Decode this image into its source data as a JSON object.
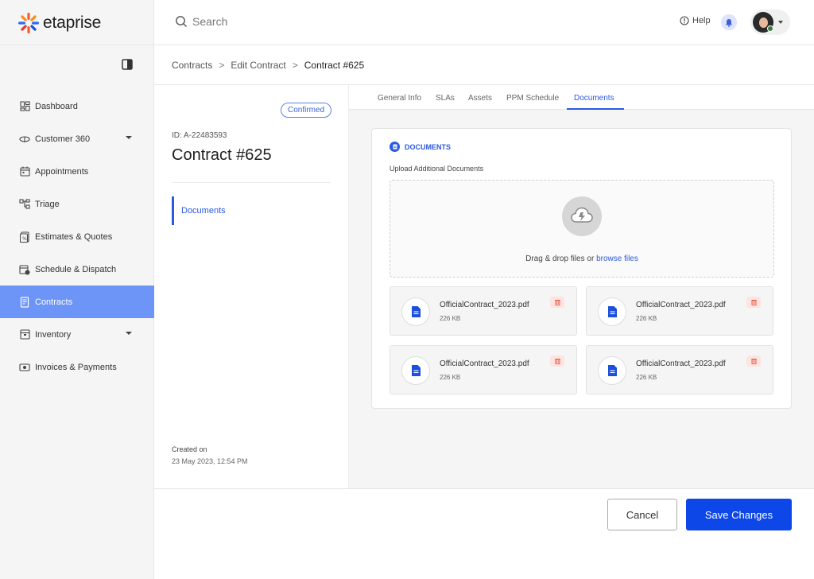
{
  "app": {
    "name": "etaprise"
  },
  "topbar": {
    "search_placeholder": "Search",
    "help_label": "Help"
  },
  "sidebar": {
    "items": [
      {
        "label": "Dashboard",
        "icon": "dashboard-icon",
        "active": false,
        "has_caret": false
      },
      {
        "label": "Customer 360",
        "icon": "customer-360-icon",
        "active": false,
        "has_caret": true
      },
      {
        "label": "Appointments",
        "icon": "calendar-icon",
        "active": false,
        "has_caret": false
      },
      {
        "label": "Triage",
        "icon": "triage-icon",
        "active": false,
        "has_caret": false
      },
      {
        "label": "Estimates & Quotes",
        "icon": "estimates-icon",
        "active": false,
        "has_caret": false
      },
      {
        "label": "Schedule & Dispatch",
        "icon": "schedule-icon",
        "active": false,
        "has_caret": false
      },
      {
        "label": "Contracts",
        "icon": "contracts-icon",
        "active": true,
        "has_caret": false
      },
      {
        "label": "Inventory",
        "icon": "inventory-icon",
        "active": false,
        "has_caret": true
      },
      {
        "label": "Invoices & Payments",
        "icon": "invoices-icon",
        "active": false,
        "has_caret": false
      }
    ]
  },
  "breadcrumb": {
    "items": [
      "Contracts",
      "Edit Contract",
      "Contract #625"
    ]
  },
  "detail": {
    "status": "Confirmed",
    "id_label": "ID: A-22483593",
    "title": "Contract #625",
    "nav_item": "Documents",
    "created_label": "Created on",
    "created_value": "23 May 2023, 12:54 PM"
  },
  "tabs": [
    {
      "label": "General Info",
      "active": false
    },
    {
      "label": "SLAs",
      "active": false
    },
    {
      "label": "Assets",
      "active": false
    },
    {
      "label": "PPM Schedule",
      "active": false
    },
    {
      "label": "Documents",
      "active": true
    }
  ],
  "documents": {
    "section_title": "DOCUMENTS",
    "upload_label": "Upload Additional Documents",
    "drop_text": "Drag & drop files or",
    "browse_link": "browse files",
    "files": [
      {
        "name": "OfficialContract_2023.pdf",
        "size": "226 KB"
      },
      {
        "name": "OfficialContract_2023.pdf",
        "size": "226 KB"
      },
      {
        "name": "OfficialContract_2023.pdf",
        "size": "226 KB"
      },
      {
        "name": "OfficialContract_2023.pdf",
        "size": "226 KB"
      }
    ]
  },
  "footer": {
    "cancel_label": "Cancel",
    "save_label": "Save Changes"
  },
  "colors": {
    "accent": "#2c59e0",
    "sidebar_active": "#6d95f7",
    "save_button": "#0d47e8",
    "delete_bg": "#fde4e1"
  }
}
